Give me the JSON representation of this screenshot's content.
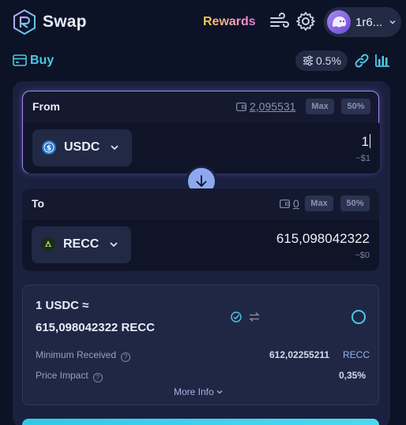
{
  "header": {
    "brand": "Swap",
    "rewards": "Rewards",
    "wallet_address": "1r6...",
    "icons": {
      "logo": "raydium-logo",
      "settings": "gear-icon",
      "priority": "wind-icon",
      "wallet": "ghost-avatar"
    }
  },
  "subbar": {
    "buy_label": "Buy",
    "slippage": "0.5%"
  },
  "from": {
    "label": "From",
    "balance": "2,095531",
    "max_label": "Max",
    "half_label": "50%",
    "token": "USDC",
    "amount": "1",
    "usd": "~$1",
    "token_color": "#2775ca"
  },
  "to": {
    "label": "To",
    "balance": "0",
    "max_label": "Max",
    "half_label": "50%",
    "token": "RECC",
    "amount": "615,098042322",
    "usd": "~$0",
    "token_color": "#1c2a1c"
  },
  "info": {
    "rate_line1": "1 USDC ≈",
    "rate_line2": "615,098042322 RECC",
    "min_received_label": "Minimum Received",
    "min_received_value": "612,02255211",
    "min_received_unit": "RECC",
    "price_impact_label": "Price Impact",
    "price_impact_value": "0,35%",
    "more_info": "More Info"
  },
  "colors": {
    "accent": "#4fc8e6",
    "border_active": "#a488f3",
    "background": "#0d1326"
  }
}
